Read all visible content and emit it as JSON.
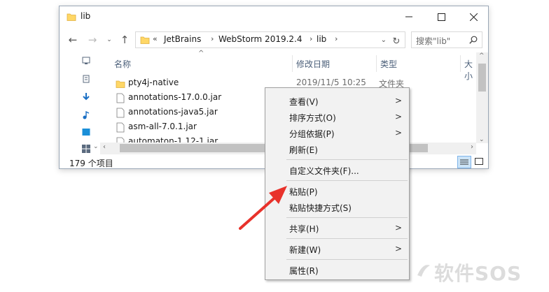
{
  "window": {
    "title": "lib",
    "controls": [
      "minimize-icon",
      "maximize-icon",
      "close-icon"
    ]
  },
  "address_bar": {
    "overflow": "«",
    "crumbs": [
      "JetBrains",
      "WebStorm 2019.2.4",
      "lib"
    ]
  },
  "search": {
    "placeholder": "搜索\"lib\""
  },
  "columns": {
    "name": "名称",
    "date": "修改日期",
    "type": "类型",
    "size": "大小"
  },
  "files": [
    {
      "name": "pty4j-native",
      "kind": "folder",
      "date": "2019/11/5 10:25",
      "type": "文件夹"
    },
    {
      "name": "annotations-17.0.0.jar",
      "kind": "file"
    },
    {
      "name": "annotations-java5.jar",
      "kind": "file"
    },
    {
      "name": "asm-all-7.0.1.jar",
      "kind": "file"
    },
    {
      "name": "automaton-1.12-1.jar",
      "kind": "file"
    }
  ],
  "status": {
    "item_count": "179 个项目"
  },
  "context_menu": {
    "items": [
      {
        "label": "查看(V)",
        "submenu": true
      },
      {
        "label": "排序方式(O)",
        "submenu": true
      },
      {
        "label": "分组依据(P)",
        "submenu": true
      },
      {
        "label": "刷新(E)",
        "submenu": false
      },
      {
        "label": "自定义文件夹(F)...",
        "submenu": false
      },
      {
        "label": "粘贴(P)",
        "submenu": false
      },
      {
        "label": "粘贴快捷方式(S)",
        "submenu": false
      },
      {
        "label": "共享(H)",
        "submenu": true
      },
      {
        "label": "新建(W)",
        "submenu": true
      },
      {
        "label": "属性(R)",
        "submenu": false
      }
    ]
  },
  "annotation": {
    "color": "#e8322b"
  },
  "watermark": {
    "text": "软件SOS"
  },
  "colors": {
    "folder": "#ffd766",
    "accent": "#0078d7"
  }
}
